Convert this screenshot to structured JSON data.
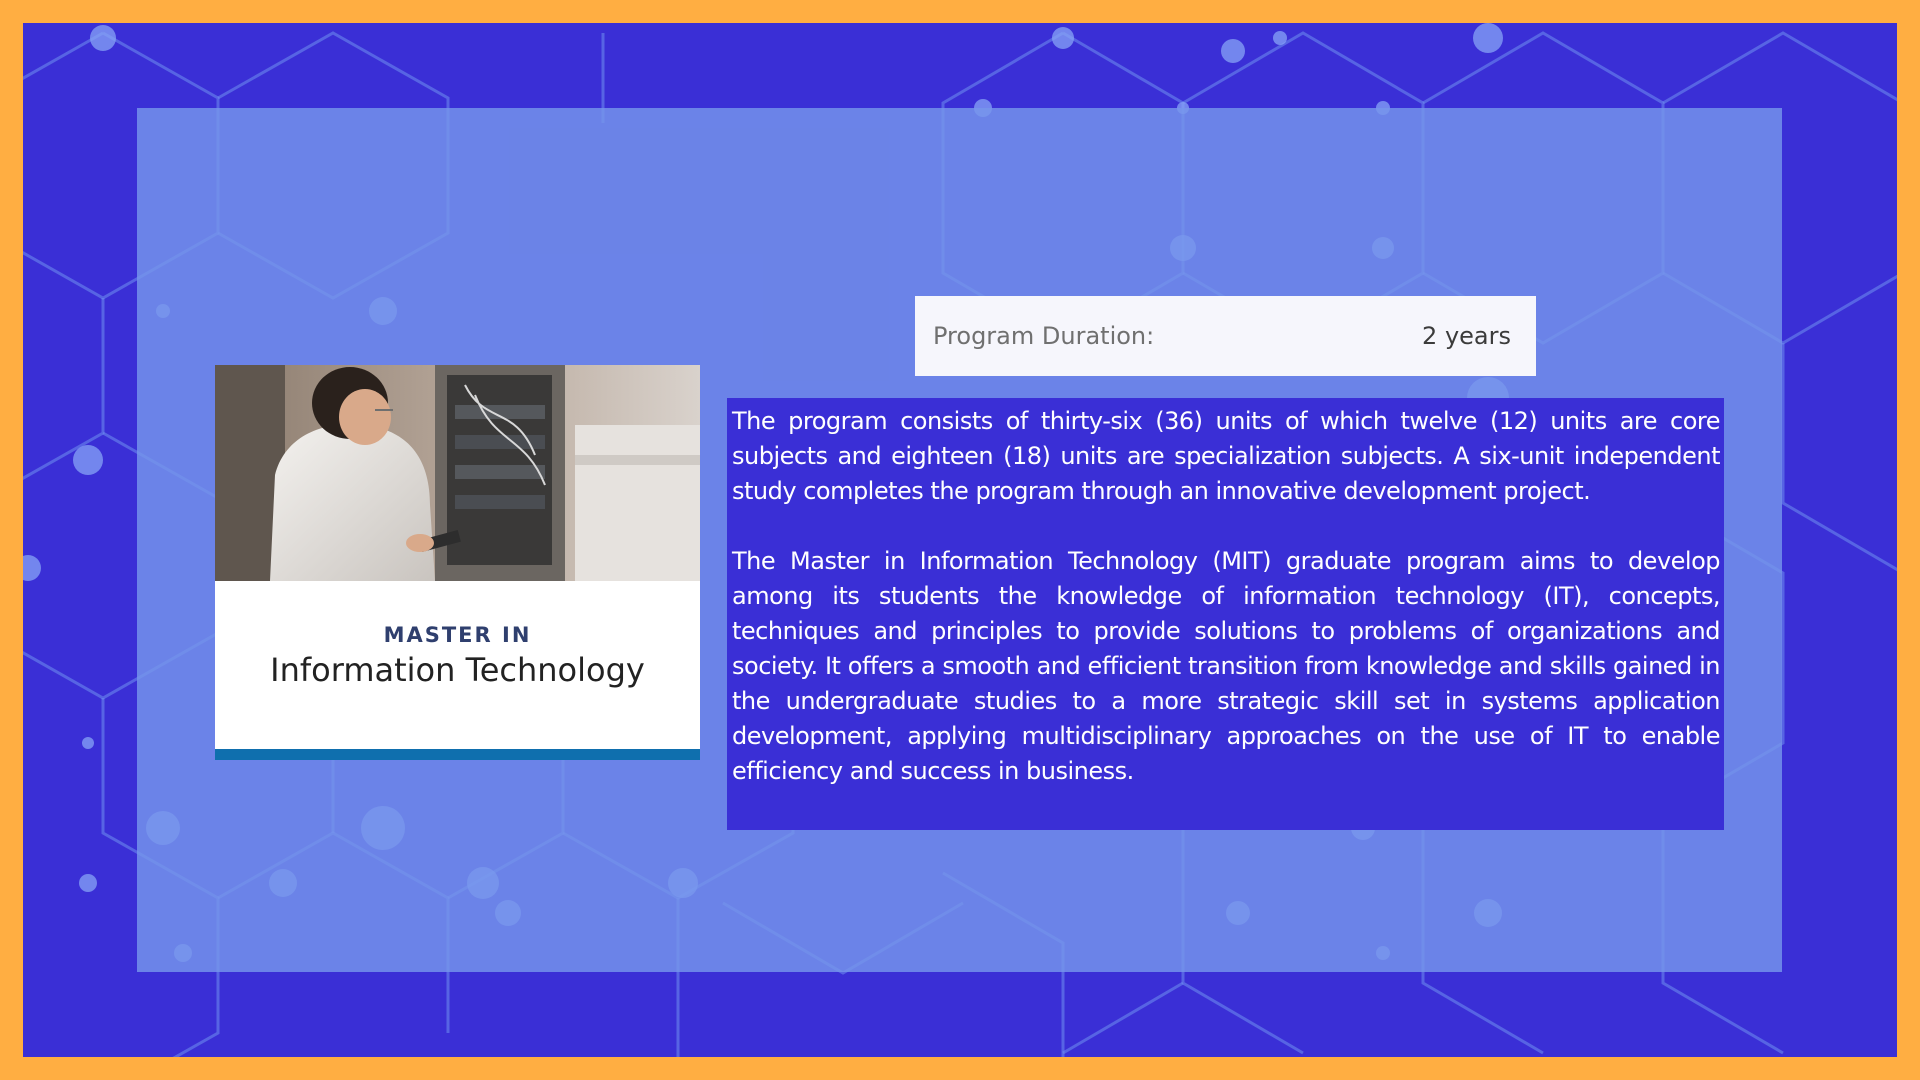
{
  "program": {
    "duration_label": "Program Duration:",
    "duration_value": "2 years",
    "card_subtitle": "MASTER IN",
    "card_title": "Information Technology",
    "description": [
      "The program consists of thirty-six (36) units of which twelve (12) units are core subjects and eighteen (18) units are specialization subjects. A six-unit independent study completes the program through an innovative development project.",
      "The Master in Information Technology (MIT) graduate program aims to develop among its students the knowledge of information technology (IT), concepts, techniques and principles to provide solutions to problems of organizations and society. It offers a smooth and efficient transition from knowledge and skills gained in the undergraduate studies to a more strategic skill set in systems application development, applying multidisciplinary approaches on the use of IT to enable efficiency and success in business."
    ]
  },
  "colors": {
    "border": "#ffae42",
    "background": "#3a2fd6",
    "panel": "#7696eb",
    "card_bar": "#0f6fae"
  },
  "icons": {
    "card_image": "technician-server-rack-photo",
    "background_pattern": "hexagon-network-pattern"
  }
}
